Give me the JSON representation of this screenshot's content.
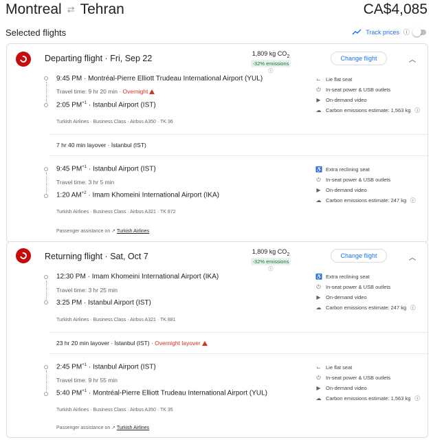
{
  "header": {
    "origin": "Montreal",
    "swap_icon": "⇄",
    "destination": "Tehran",
    "price": "CA$4,085",
    "selected_label": "Selected flights",
    "track_label": "Track prices"
  },
  "departing": {
    "title": "Departing flight",
    "date": "Fri, Sep 22",
    "co2": "1,809 kg CO",
    "co2_sub": "2",
    "emissions_badge": "-32% emissions",
    "change_label": "Change flight",
    "seg1": {
      "dep_time": "9:45 PM",
      "dep_airport": "Montréal-Pierre Elliott Trudeau International Airport (YUL)",
      "travel_time": "Travel time: 9 hr 20 min",
      "overnight": "Overnight",
      "arr_time": "2:05 PM",
      "arr_sup": "+1",
      "arr_airport": "Istanbul Airport (IST)",
      "meta": [
        "Turkish Airlines",
        "Business Class",
        "Airbus A350",
        "TK 36"
      ],
      "amenities": [
        "Lie flat seat",
        "In-seat power & USB outlets",
        "On-demand video",
        "Carbon emissions estimate: 1,563 kg"
      ]
    },
    "layover": "7 hr 40 min layover · İstanbul (IST)",
    "seg2": {
      "dep_time": "9:45 PM",
      "dep_sup": "+1",
      "dep_airport": "Istanbul Airport (IST)",
      "travel_time": "Travel time: 3 hr 5 min",
      "arr_time": "1:20 AM",
      "arr_sup": "+2",
      "arr_airport": "Imam Khomeini International Airport (IKA)",
      "meta": [
        "Turkish Airlines",
        "Business Class",
        "Airbus A321",
        "TK 872"
      ],
      "amenities": [
        "Extra reclining seat",
        "In-seat power & USB outlets",
        "On-demand video",
        "Carbon emissions estimate: 247 kg"
      ]
    },
    "assist_prefix": "Passenger assistance on",
    "assist_link": "Turkish Airlines"
  },
  "returning": {
    "title": "Returning flight",
    "date": "Sat, Oct 7",
    "co2": "1,809 kg CO",
    "co2_sub": "2",
    "emissions_badge": "-32% emissions",
    "change_label": "Change flight",
    "seg1": {
      "dep_time": "12:30 PM",
      "dep_airport": "Imam Khomeini International Airport (IKA)",
      "travel_time": "Travel time: 3 hr 25 min",
      "arr_time": "3:25 PM",
      "arr_airport": "Istanbul Airport (IST)",
      "meta": [
        "Turkish Airlines",
        "Business Class",
        "Airbus A321",
        "TK 881"
      ],
      "amenities": [
        "Extra reclining seat",
        "In-seat power & USB outlets",
        "On-demand video",
        "Carbon emissions estimate: 247 kg"
      ]
    },
    "layover": "23 hr 20 min layover · İstanbul (IST)",
    "layover_warning": "Overnight layover",
    "seg2": {
      "dep_time": "2:45 PM",
      "dep_sup": "+1",
      "dep_airport": "Istanbul Airport (IST)",
      "travel_time": "Travel time: 9 hr 55 min",
      "arr_time": "5:40 PM",
      "arr_sup": "+1",
      "arr_airport": "Montréal-Pierre Elliott Trudeau International Airport (YUL)",
      "meta": [
        "Turkish Airlines",
        "Business Class",
        "Airbus A350",
        "TK 35"
      ],
      "amenities": [
        "Lie flat seat",
        "In-seat power & USB outlets",
        "On-demand video",
        "Carbon emissions estimate: 1,563 kg"
      ]
    },
    "assist_prefix": "Passenger assistance on",
    "assist_link": "Turkish Airlines"
  },
  "icons": {
    "seat": "seat-icon",
    "power": "power-plug-icon",
    "video": "video-icon",
    "co2": "co2-icon",
    "info": "info-icon",
    "warning": "warning-icon",
    "chevron": "chevron-up-icon",
    "trend": "trend-icon",
    "external": "external-link-icon"
  },
  "colors": {
    "accent": "#1a73e8",
    "warning": "#d93025",
    "eco_green": "#137333",
    "airline": "#c70a0c"
  }
}
